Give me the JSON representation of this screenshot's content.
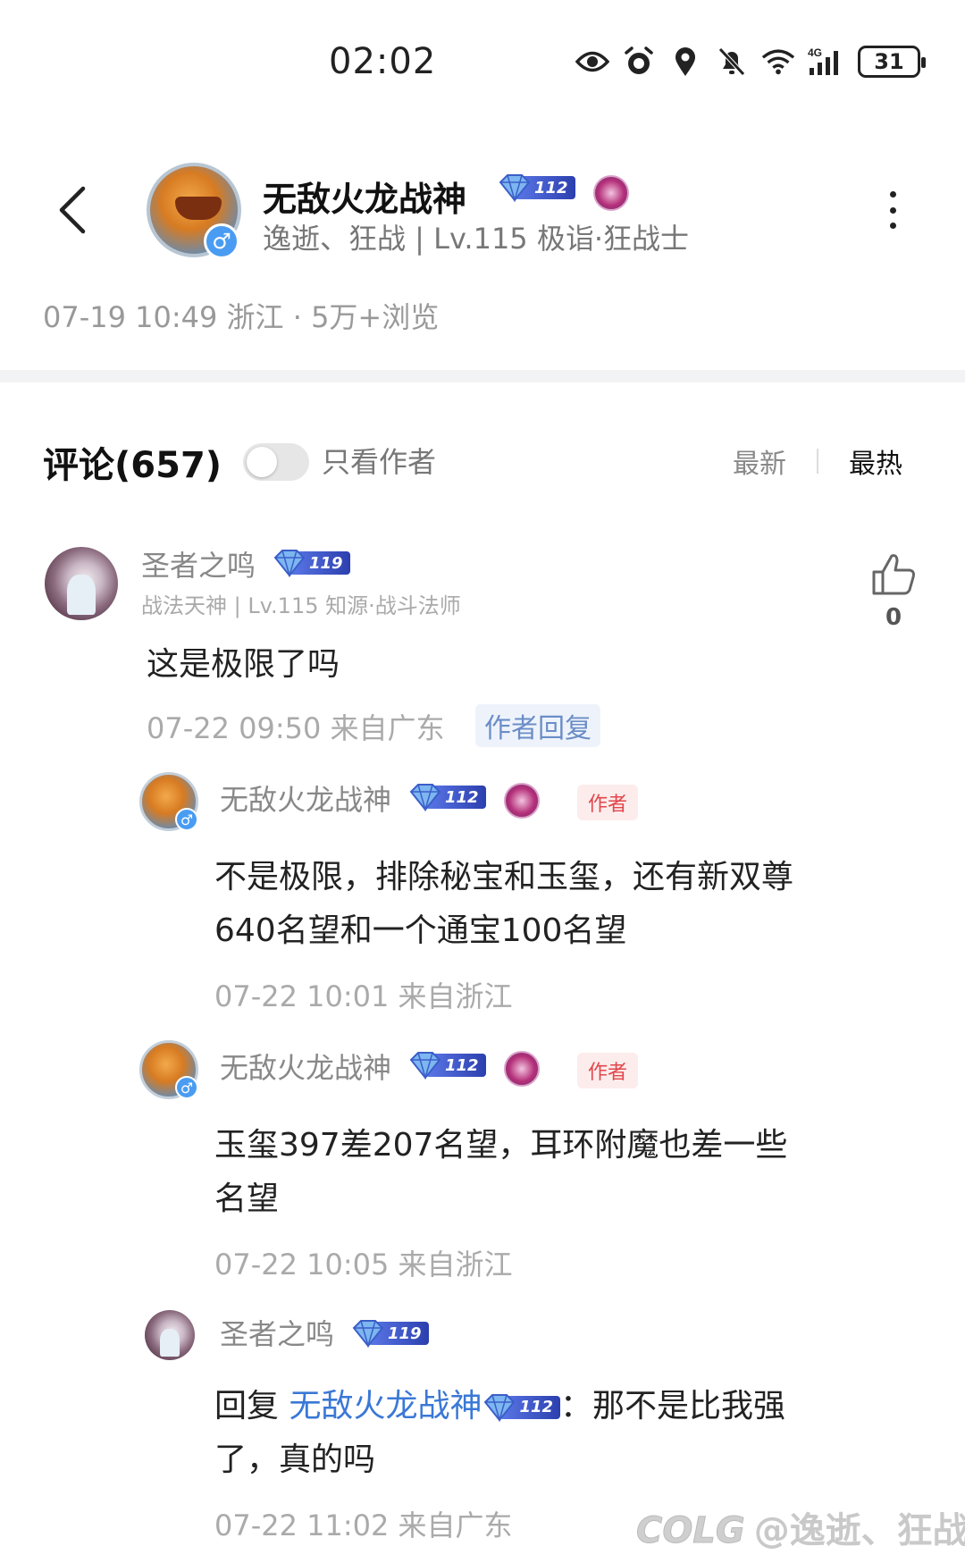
{
  "status_bar": {
    "time": "02:02",
    "icons": [
      "eye-icon",
      "alarm-icon",
      "location-icon",
      "bell-off-icon",
      "wifi-icon",
      "signal-4g-icon"
    ],
    "battery": "31"
  },
  "post_header": {
    "author_name": "无敌火龙战神",
    "author_level_badge": "112",
    "author_subtitle": "逸逝、狂战 | Lv.115 极诣·狂战士",
    "meta": "07-19 10:49 浙江 · 5万+浏览"
  },
  "comments_header": {
    "title": "评论(657)",
    "only_author_label": "只看作者",
    "sort_newest": "最新",
    "sort_hot": "最热"
  },
  "comment": {
    "user_name": "圣者之鸣",
    "level_badge": "119",
    "user_subtitle": "战法天神 | Lv.115 知源·战斗法师",
    "text": "这是极限了吗",
    "meta": "07-22 09:50  来自广东",
    "author_reply_tag": "作者回复",
    "like_count": "0"
  },
  "replies": [
    {
      "user_name": "无敌火龙战神",
      "level_badge": "112",
      "author_tag": "作者",
      "text_line1": "不是极限，排除秘宝和玉玺，还有新双尊",
      "text_line2": "640名望和一个通宝100名望",
      "meta": "07-22 10:01  来自浙江"
    },
    {
      "user_name": "无敌火龙战神",
      "level_badge": "112",
      "author_tag": "作者",
      "text_line1": "玉玺397差207名望，耳环附魔也差一些",
      "text_line2": "名望",
      "meta": "07-22 10:05  来自浙江"
    },
    {
      "user_name": "圣者之鸣",
      "level_badge": "119",
      "reply_prefix": "回复 ",
      "mention": "无敌火龙战神",
      "mention_level_badge": "112",
      "text_line1_rest": "：那不是比我强",
      "text_line2": "了，真的吗",
      "meta": "07-22 11:02  来自广东"
    }
  ],
  "watermark": {
    "logo": "COLG",
    "text": "@逸逝、狂战"
  }
}
